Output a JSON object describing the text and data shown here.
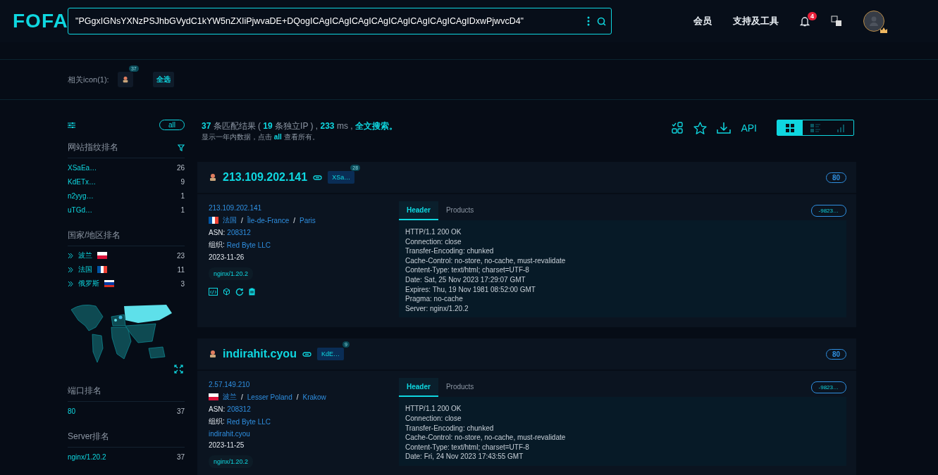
{
  "header": {
    "logo": "FOFA",
    "search": {
      "value": "\"PGgxIGNsYXNzPSJhbGVydC1kYW5nZXIiPjwvaDE+DQogICAgICAgICAgICAgICAgICAgICAgICAgIDxwPjwvcD4\""
    },
    "nav": [
      "会员",
      "支持及工具"
    ],
    "notifications": "4"
  },
  "related_icons": {
    "label": "相关icon(1):",
    "icons": [
      {
        "count": "37",
        "selected": false
      }
    ],
    "select_all": "全选"
  },
  "sidebar": {
    "all_button": "all",
    "sections": [
      {
        "kind": "list",
        "title": "网站指纹排名",
        "filter": true,
        "items": [
          {
            "label": "XSaEa…",
            "count": "26"
          },
          {
            "label": "KdETx…",
            "count": "9"
          },
          {
            "label": "n2yyg…",
            "count": "1"
          },
          {
            "label": "uTGd…",
            "count": "1"
          }
        ]
      },
      {
        "kind": "countries",
        "title": "国家/地区排名",
        "filter": false,
        "items": [
          {
            "label": "波兰",
            "count": "23",
            "expanded": false,
            "flag": {
              "kind": "horizontal",
              "stripes": [
                {
                  "color": "#ffffff"
                },
                {
                  "color": "#dc143c"
                }
              ]
            }
          },
          {
            "label": "法国",
            "count": "11",
            "expanded": false,
            "flag": {
              "kind": "vertical",
              "stripes": [
                {
                  "color": "#0055a4"
                },
                {
                  "color": "#ffffff"
                },
                {
                  "color": "#ef4135"
                }
              ]
            }
          },
          {
            "label": "俄罗斯",
            "count": "3",
            "expanded": false,
            "flag": {
              "kind": "horizontal",
              "stripes": [
                {
                  "color": "#ffffff"
                },
                {
                  "color": "#0039a6"
                },
                {
                  "color": "#d52b1e"
                }
              ]
            }
          }
        ]
      },
      {
        "kind": "map"
      },
      {
        "kind": "list",
        "title": "端口排名",
        "filter": false,
        "items": [
          {
            "label": "80",
            "count": "37"
          }
        ]
      },
      {
        "kind": "list",
        "title": "Server排名",
        "filter": false,
        "items": [
          {
            "label": "nginx/1.20.2",
            "count": "37"
          }
        ]
      }
    ]
  },
  "summary": {
    "line": "**37** 条匹配结果 ( **19** 条独立IP ) , **233** ms , ",
    "link": "全文搜索。",
    "note": "显示一年内数据，点击 **all** 查看所有。"
  },
  "toolbar": {
    "api": "API",
    "views": [
      {
        "kind": "grid",
        "selected": true
      },
      {
        "kind": "list",
        "selected": false
      },
      {
        "kind": "chart",
        "selected": false
      }
    ]
  },
  "results": [
    {
      "title": "213.109.202.141",
      "tag": "XSa…",
      "tag_count": "28",
      "port": "80",
      "ip": "213.109.202.141",
      "country": "法国",
      "region": "Île-de-France",
      "city": "Paris",
      "flag": {
        "kind": "vertical",
        "stripes": [
          {
            "color": "#0055a4"
          },
          {
            "color": "#ffffff"
          },
          {
            "color": "#ef4135"
          }
        ]
      },
      "separators": [
        "/",
        "/"
      ],
      "asn_label": "ASN:",
      "asn": "208312",
      "org_label": "组织:",
      "org": "Red Byte LLC",
      "date": "2023-11-26",
      "server": "nginx/1.20.2",
      "actions": true,
      "tabs": [
        {
          "label": "Header",
          "selected": true
        },
        {
          "label": "Products",
          "selected": false
        }
      ],
      "hash": "-9823…",
      "header_lines": [
        "HTTP/1.1 200 OK",
        "Connection: close",
        "Transfer-Encoding: chunked",
        "Cache-Control: no-store, no-cache, must-revalidate",
        "Content-Type: text/html; charset=UTF-8",
        "Date: Sat, 25 Nov 2023 17:29:07 GMT",
        "Expires: Thu, 19 Nov 1981 08:52:00 GMT",
        "Pragma: no-cache",
        "Server: nginx/1.20.2"
      ]
    },
    {
      "title": "indirahit.cyou",
      "tag": "KdE…",
      "tag_count": "9",
      "port": "80",
      "ip": "2.57.149.210",
      "country": "波兰",
      "region": "Lesser Poland",
      "city": "Krakow",
      "flag": {
        "kind": "horizontal",
        "stripes": [
          {
            "color": "#ffffff"
          },
          {
            "color": "#dc143c"
          }
        ]
      },
      "separators": [
        "/",
        "/"
      ],
      "asn_label": "ASN:",
      "asn": "208312",
      "org_label": "组织:",
      "org": "Red Byte LLC",
      "domain": "indirahit.cyou",
      "date": "2023-11-25",
      "server": "nginx/1.20.2",
      "actions": false,
      "tabs": [
        {
          "label": "Header",
          "selected": true
        },
        {
          "label": "Products",
          "selected": false
        }
      ],
      "hash": "-9823…",
      "header_lines": [
        "HTTP/1.1 200 OK",
        "Connection: close",
        "Transfer-Encoding: chunked",
        "Cache-Control: no-store, no-cache, must-revalidate",
        "Content-Type: text/html; charset=UTF-8",
        "Date: Fri, 24 Nov 2023 17:43:55 GMT"
      ]
    }
  ]
}
